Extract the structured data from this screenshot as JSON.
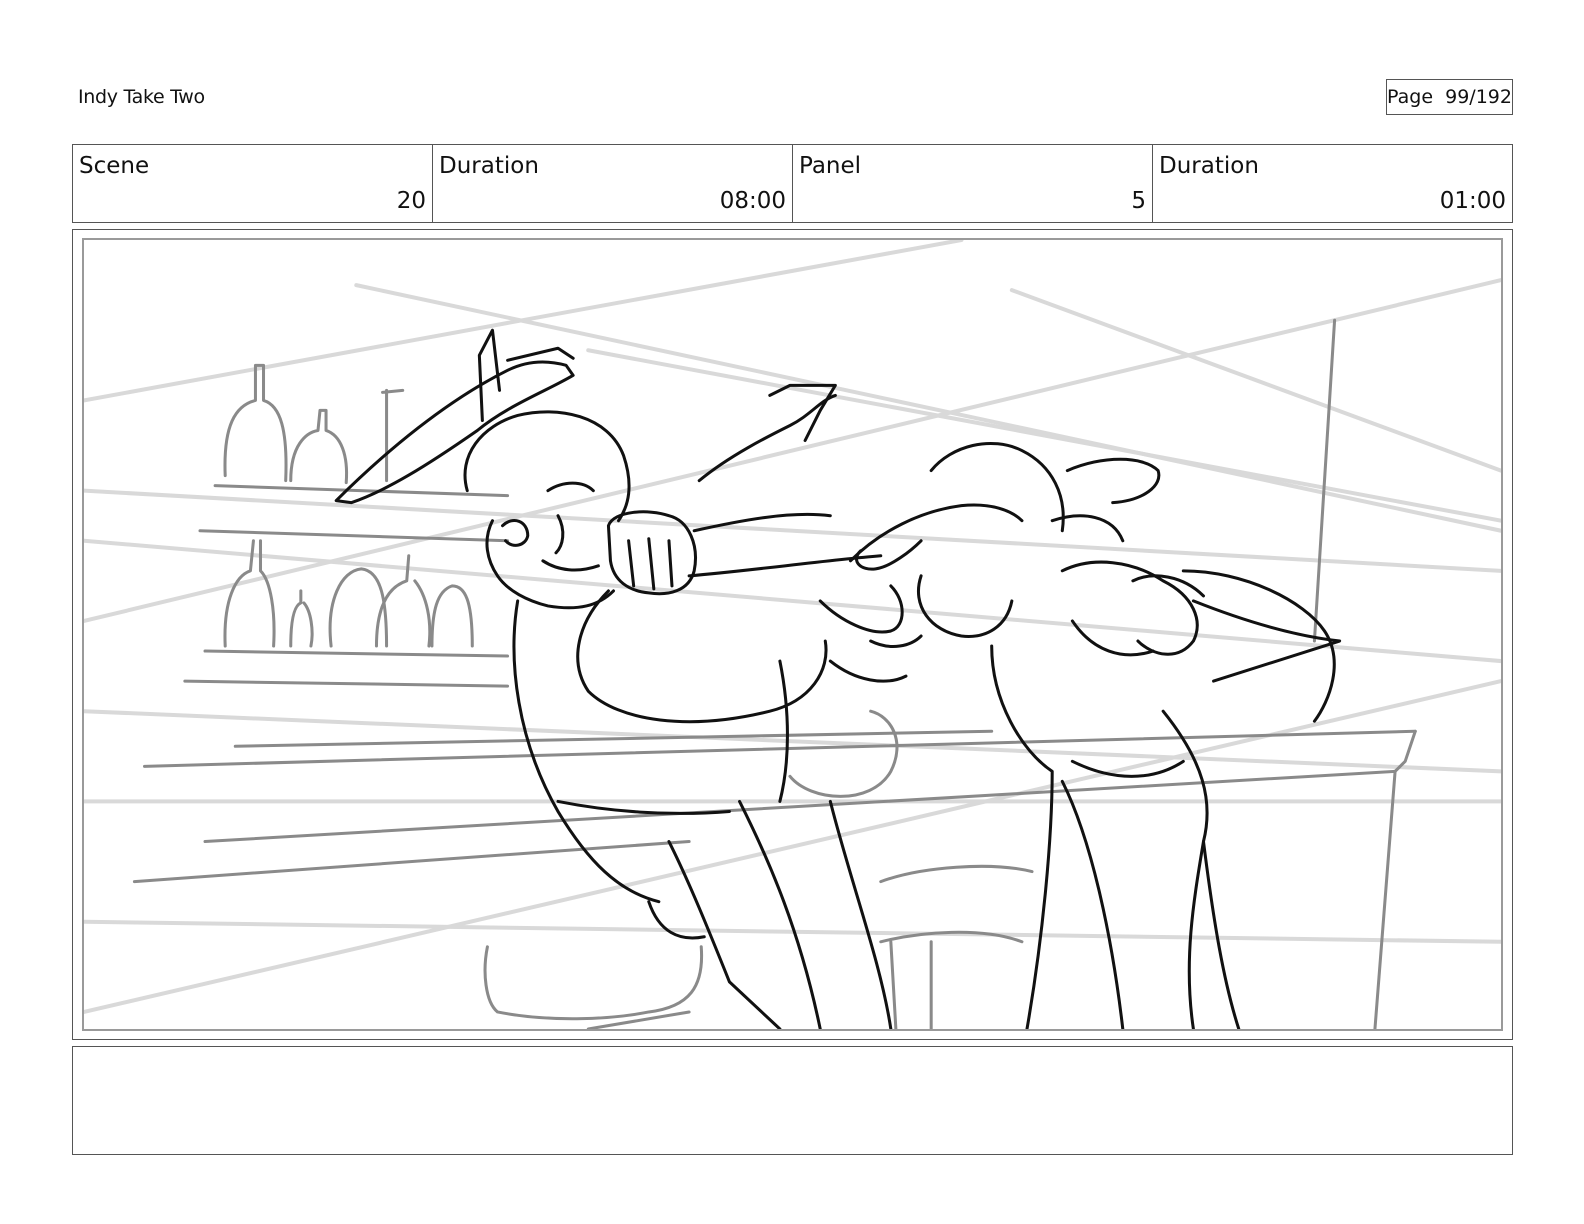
{
  "document": {
    "title": "Indy Take Two",
    "page_label": "Page",
    "page_value": "99/192"
  },
  "info": {
    "scene_label": "Scene",
    "scene_value": "20",
    "scene_duration_label": "Duration",
    "scene_duration_value": "08:00",
    "panel_label": "Panel",
    "panel_value": "5",
    "panel_duration_label": "Duration",
    "panel_duration_value": "01:00"
  },
  "notes": {
    "text": ""
  }
}
